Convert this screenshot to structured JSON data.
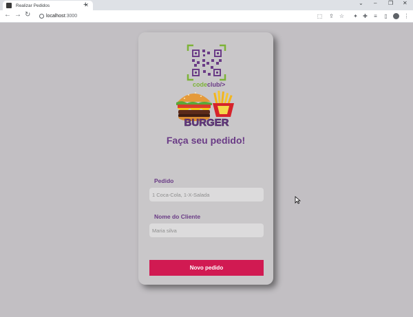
{
  "browser": {
    "tab_title": "Realizar Pedidos",
    "url_host": "localhost",
    "url_port": ":3000"
  },
  "logo": {
    "brand_code": "code",
    "brand_club": "club/>",
    "burger_text": "BURGER"
  },
  "form": {
    "heading": "Faça seu pedido!",
    "order_label": "Pedido",
    "order_placeholder": "1 Coca-Cola, 1-X-Salada",
    "customer_label": "Nome do Cliente",
    "customer_placeholder": "Maria silva",
    "submit_label": "Novo pedido"
  },
  "colors": {
    "accent": "#d11a52",
    "heading": "#6a3b86",
    "background": "#c2bfc3",
    "card": "#c9c7c9"
  }
}
